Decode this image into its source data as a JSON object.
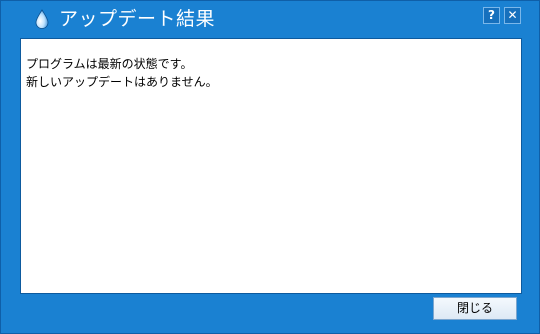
{
  "window": {
    "title": "アップデート結果",
    "help_label": "?",
    "close_label": "✕"
  },
  "message": {
    "line1": "プログラムは最新の状態です。",
    "line2": "新しいアップデートはありません。"
  },
  "footer": {
    "close_button_label": "閉じる"
  },
  "colors": {
    "window_background": "#1a81d2",
    "content_background": "#ffffff"
  },
  "icons": {
    "app": "droplet-icon"
  }
}
